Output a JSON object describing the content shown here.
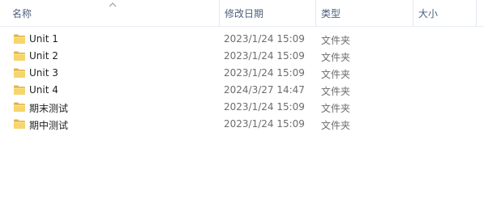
{
  "columns": {
    "name": "名称",
    "date": "修改日期",
    "type": "类型",
    "size": "大小"
  },
  "rows": [
    {
      "name": "Unit 1",
      "date": "2023/1/24 15:09",
      "type": "文件夹",
      "icon": "folder-icon"
    },
    {
      "name": "Unit 2",
      "date": "2023/1/24 15:09",
      "type": "文件夹",
      "icon": "folder-icon"
    },
    {
      "name": "Unit 3",
      "date": "2023/1/24 15:09",
      "type": "文件夹",
      "icon": "folder-icon"
    },
    {
      "name": "Unit 4",
      "date": "2024/3/27 14:47",
      "type": "文件夹",
      "icon": "folder-icon"
    },
    {
      "name": "期末测试",
      "date": "2023/1/24 15:09",
      "type": "文件夹",
      "icon": "folder-icon"
    },
    {
      "name": "期中测试",
      "date": "2023/1/24 15:09",
      "type": "文件夹",
      "icon": "folder-icon"
    }
  ]
}
